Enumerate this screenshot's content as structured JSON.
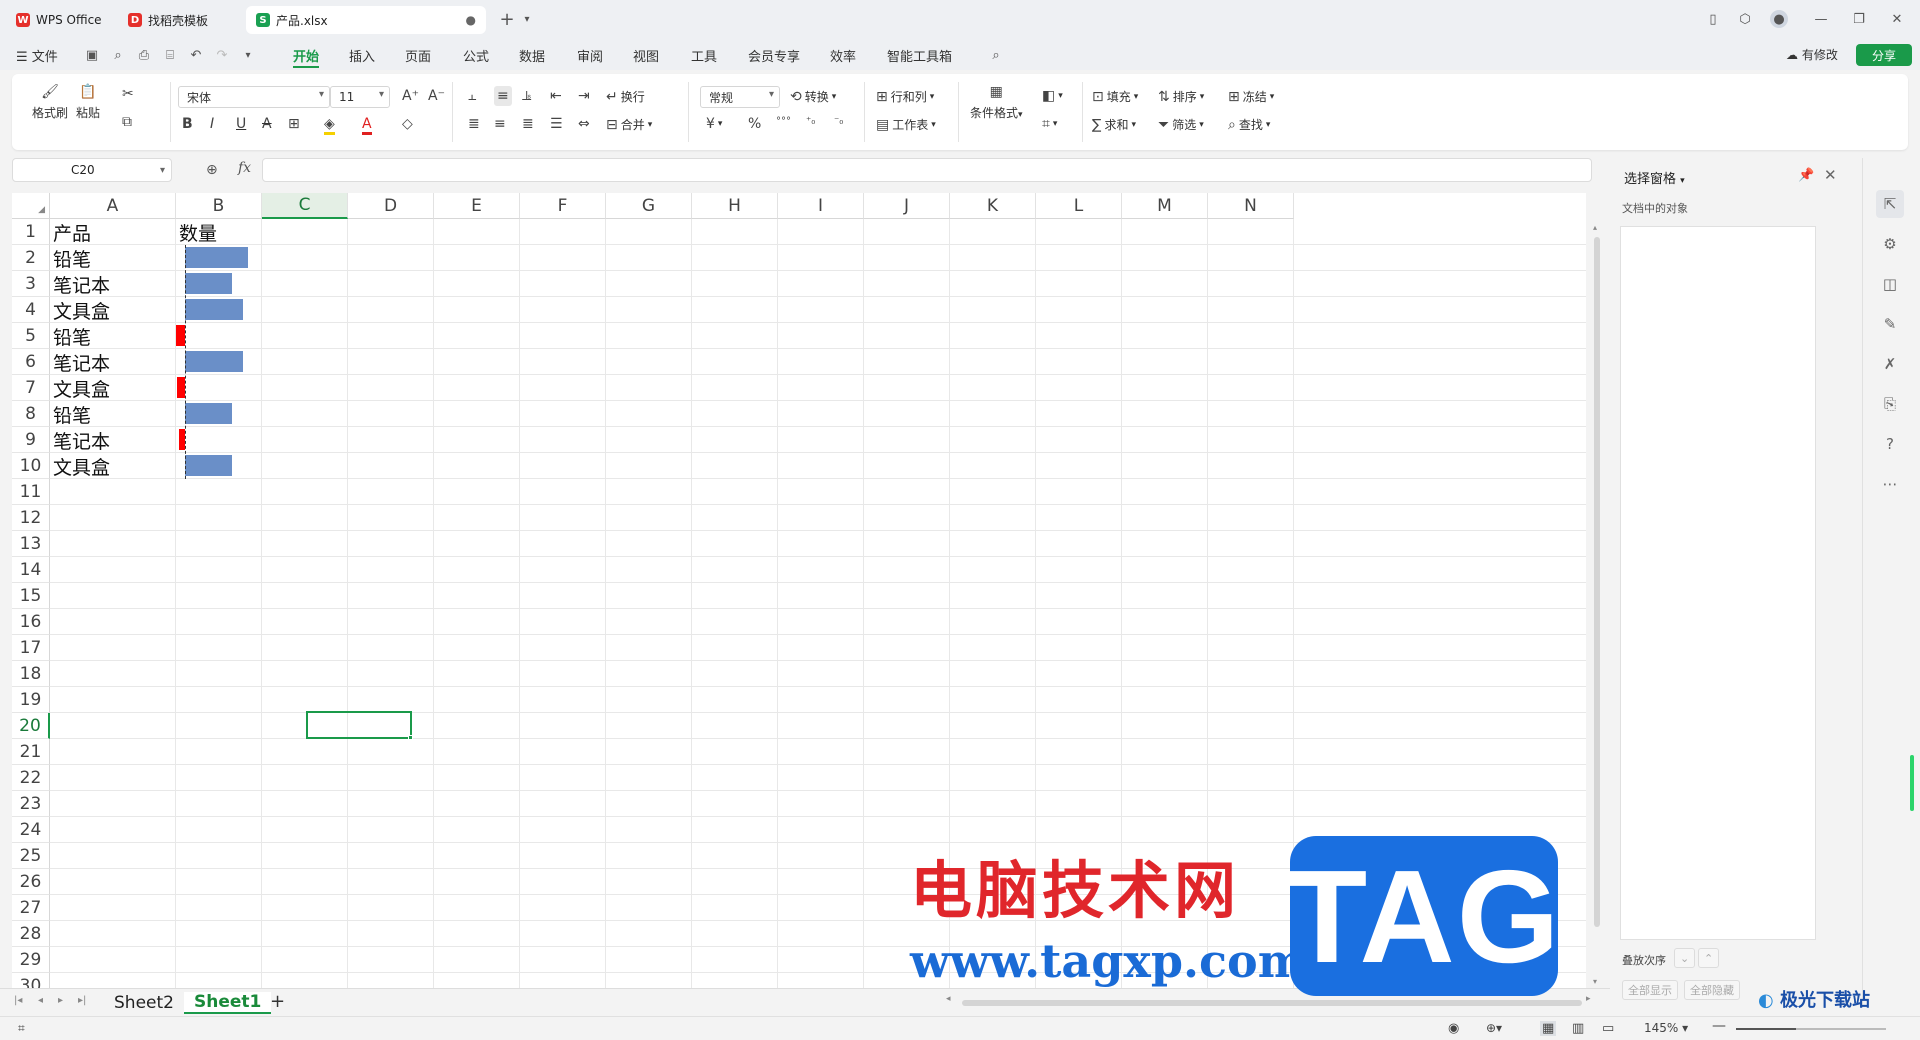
{
  "titlebar": {
    "tabs": [
      {
        "label": "WPS Office",
        "icon": "wps-logo-icon",
        "color": "#e5302b"
      },
      {
        "label": "找稻壳模板",
        "icon": "docer-icon",
        "color": "#e5302b"
      },
      {
        "label": "产品.xlsx",
        "icon": "spreadsheet-icon",
        "color": "#1aa052",
        "icon_letter": "S"
      }
    ]
  },
  "menubar": {
    "file": "文件",
    "items": [
      "开始",
      "插入",
      "页面",
      "公式",
      "数据",
      "审阅",
      "视图",
      "工具",
      "会员专享",
      "效率",
      "智能工具箱"
    ],
    "active": "开始",
    "has_changes": "有修改",
    "share": "分享",
    "accent": "#1a9a4a"
  },
  "ribbon": {
    "format_painter": "格式刷",
    "paste": "粘贴",
    "font_name": "宋体",
    "font_size": "11",
    "wrap": "换行",
    "merge": "合并",
    "number_format": "常规",
    "convert": "转换",
    "row_col": "行和列",
    "worksheet": "工作表",
    "cond_format": "条件格式",
    "fill": "填充",
    "sort": "排序",
    "freeze": "冻结",
    "sum": "求和",
    "filter": "筛选",
    "find": "查找",
    "currency_symbol": "¥",
    "percent_symbol": "%"
  },
  "formula_bar": {
    "name_box": "C20",
    "fx": "fx",
    "content": ""
  },
  "sheet": {
    "columns": [
      "A",
      "B",
      "C",
      "D",
      "E",
      "F",
      "G",
      "H",
      "I",
      "J",
      "K",
      "L",
      "M",
      "N"
    ],
    "selected_column": "C",
    "selected_row": 20,
    "rows": [
      "1",
      "2",
      "3",
      "4",
      "5",
      "6",
      "7",
      "8",
      "9",
      "10",
      "11",
      "12",
      "13",
      "14",
      "15",
      "16",
      "17",
      "18",
      "19",
      "20",
      "21",
      "22",
      "23",
      "24",
      "25",
      "26",
      "27",
      "28",
      "29",
      "30"
    ],
    "header_row": {
      "a": "产品",
      "b": "数量"
    },
    "products": [
      "铅笔",
      "笔记本",
      "文具盒",
      "铅笔",
      "笔记本",
      "文具盒",
      "铅笔",
      "笔记本",
      "文具盒"
    ],
    "databars": [
      {
        "fraction": 0.86,
        "negative": false
      },
      {
        "fraction": 0.65,
        "negative": false
      },
      {
        "fraction": 0.8,
        "negative": false
      },
      {
        "fraction": 0.12,
        "negative": true
      },
      {
        "fraction": 0.8,
        "negative": false
      },
      {
        "fraction": 0.1,
        "negative": true
      },
      {
        "fraction": 0.65,
        "negative": false
      },
      {
        "fraction": 0.06,
        "negative": true
      },
      {
        "fraction": 0.65,
        "negative": false
      }
    ],
    "positive_color": "#6a8fc8",
    "negative_color": "#ff0000"
  },
  "sheet_tabs": [
    "Sheet2",
    "Sheet1"
  ],
  "active_sheet": "Sheet1",
  "panel": {
    "title": "选择窗格",
    "subtitle": "文档中的对象",
    "stack_order": "叠放次序",
    "show_all": "全部显示",
    "hide_all": "全部隐藏"
  },
  "statusbar": {
    "zoom": "145%"
  },
  "watermark": {
    "cn_text": "电脑技术网",
    "url": "www.tagxp.com",
    "tag": "TAG",
    "logo_text": "极光下载站"
  }
}
